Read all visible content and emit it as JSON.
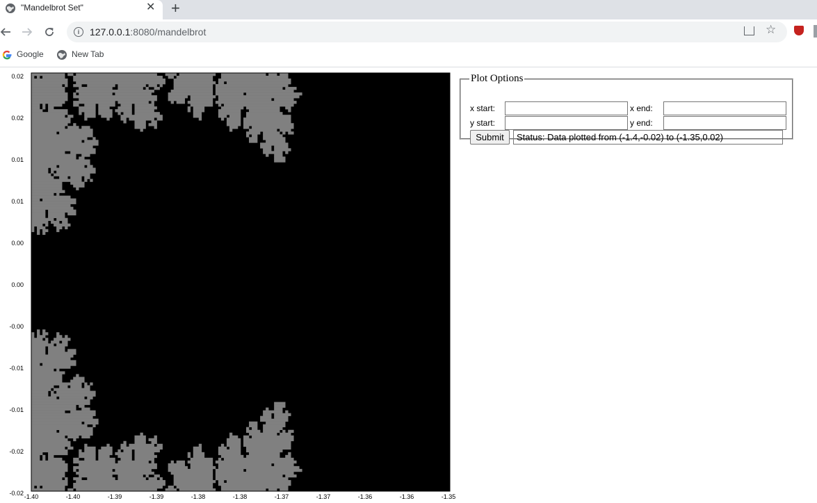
{
  "browser": {
    "tab_title": "\"Mandelbrot Set\"",
    "close_symbol": "✕",
    "new_tab_symbol": "+",
    "url_host": "127.0.0.1",
    "url_rest": ":8080/mandelbrot",
    "bookmarks": [
      {
        "label": "Google",
        "icon": "google-icon"
      },
      {
        "label": "New Tab",
        "icon": "globe-icon"
      }
    ]
  },
  "plot": {
    "y_ticks": [
      "0.02",
      "0.02",
      "0.01",
      "0.01",
      "0.00",
      "0.00",
      "-0.00",
      "-0.01",
      "-0.01",
      "-0.02",
      "-0.02"
    ],
    "x_ticks": [
      "-1.40",
      "-1.40",
      "-1.39",
      "-1.39",
      "-1.38",
      "-1.38",
      "-1.37",
      "-1.37",
      "-1.36",
      "-1.36",
      "-1.35"
    ],
    "colors": {
      "background": "#000000",
      "light": "#c8c8c8",
      "mid": "#808080",
      "set": "#000000"
    }
  },
  "chart_data": {
    "type": "heatmap",
    "title": "",
    "xlabel": "",
    "ylabel": "",
    "xlim": [
      -1.4,
      -1.35
    ],
    "ylim": [
      -0.02,
      0.02
    ],
    "description_values": "Mandelbrot set escape-time rendering"
  },
  "options": {
    "legend": "Plot Options",
    "x_start_label": "x start:",
    "x_end_label": "x end:",
    "y_start_label": "y start:",
    "y_end_label": "y end:",
    "x_start_value": "",
    "x_end_value": "",
    "y_start_value": "",
    "y_end_value": "",
    "submit_label": "Submit",
    "status_text": "Status: Data plotted from (-1.4,-0.02) to (-1.35,0.02)"
  }
}
